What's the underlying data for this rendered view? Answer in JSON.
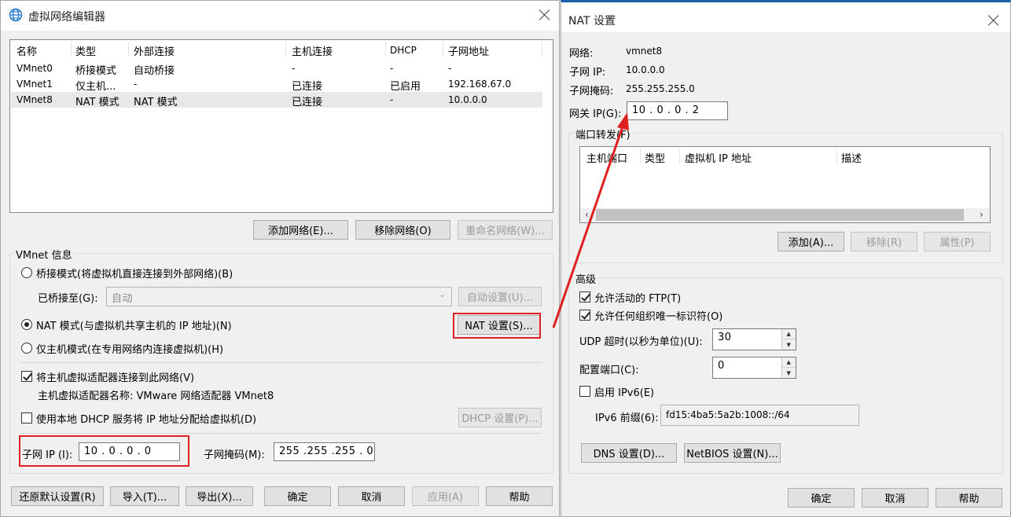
{
  "left": {
    "title": "虚拟网络编辑器",
    "columns": [
      "名称",
      "类型",
      "外部连接",
      "主机连接",
      "DHCP",
      "子网地址"
    ],
    "rows": [
      [
        "VMnet0",
        "桥接模式",
        "自动桥接",
        "-",
        "-",
        "-"
      ],
      [
        "VMnet1",
        "仅主机...",
        "-",
        "已连接",
        "已启用",
        "192.168.67.0"
      ],
      [
        "VMnet8",
        "NAT 模式",
        "NAT 模式",
        "已连接",
        "-",
        "10.0.0.0"
      ]
    ],
    "add_network": "添加网络(E)...",
    "remove_network": "移除网络(O)",
    "rename_network": "重命名网络(W)...",
    "vmnet_info": "VMnet 信息",
    "bridge_mode": "桥接模式(将虚拟机直接连接到外部网络)(B)",
    "bridged_to": "已桥接至(G):",
    "bridged_value": "自动",
    "auto_settings": "自动设置(U)...",
    "nat_mode": "NAT 模式(与虚拟机共享主机的 IP 地址)(N)",
    "nat_settings": "NAT 设置(S)...",
    "host_only": "仅主机模式(在专用网络内连接虚拟机)(H)",
    "connect_adapter": "将主机虚拟适配器连接到此网络(V)",
    "adapter_name": "主机虚拟适配器名称: VMware 网络适配器 VMnet8",
    "use_dhcp": "使用本地 DHCP 服务将 IP 地址分配给虚拟机(D)",
    "dhcp_settings": "DHCP 设置(P)...",
    "subnet_ip_label": "子网 IP (I):",
    "subnet_ip": "10 . 0 . 0 . 0",
    "subnet_mask_label": "子网掩码(M):",
    "subnet_mask": "255 .255 .255 . 0",
    "restore_defaults": "还原默认设置(R)",
    "import": "导入(T)...",
    "export": "导出(X)...",
    "ok": "确定",
    "cancel": "取消",
    "apply": "应用(A)",
    "help": "帮助"
  },
  "right": {
    "title": "NAT 设置",
    "network_label": "网络:",
    "network_value": "vmnet8",
    "subnet_ip_label": "子网 IP:",
    "subnet_ip_value": "10.0.0.0",
    "subnet_mask_label": "子网掩码:",
    "subnet_mask_value": "255.255.255.0",
    "gateway_label": "网关 IP(G):",
    "gateway_value": "10 . 0 . 0 . 2",
    "port_forwarding": "端口转发(F)",
    "pf_columns": [
      "主机端口",
      "类型",
      "虚拟机 IP 地址",
      "描述"
    ],
    "add": "添加(A)...",
    "remove": "移除(R)",
    "properties": "属性(P)",
    "advanced": "高级",
    "allow_ftp": "允许活动的 FTP(T)",
    "allow_org_id": "允许任何组织唯一标识符(O)",
    "udp_timeout_label": "UDP 超时(以秒为单位)(U):",
    "udp_timeout_value": "30",
    "config_port_label": "配置端口(C):",
    "config_port_value": "0",
    "enable_ipv6": "启用 IPv6(E)",
    "ipv6_prefix_label": "IPv6 前缀(6):",
    "ipv6_prefix_value": "fd15:4ba5:5a2b:1008::/64",
    "dns_settings": "DNS 设置(D)...",
    "netbios_settings": "NetBIOS 设置(N)...",
    "ok": "确定",
    "cancel": "取消",
    "help": "帮助"
  },
  "colors": {
    "annotation_red": "#e02020",
    "window_bg": "#f0f0f0",
    "selected_row": "#e8e8e8",
    "globe_icon": "#1a73c8"
  }
}
